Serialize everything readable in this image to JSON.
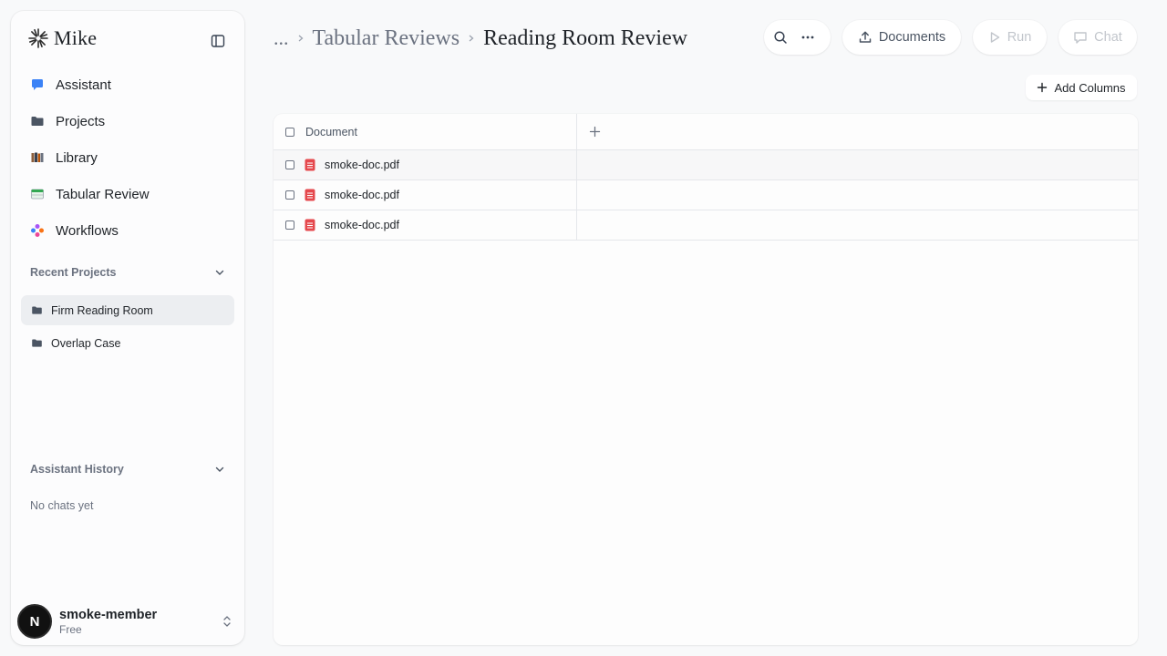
{
  "brand": {
    "name": "Mike"
  },
  "nav": [
    {
      "label": "Assistant",
      "icon": "chat-bubble-icon"
    },
    {
      "label": "Projects",
      "icon": "folder-icon"
    },
    {
      "label": "Library",
      "icon": "books-icon"
    },
    {
      "label": "Tabular Review",
      "icon": "table-icon"
    },
    {
      "label": "Workflows",
      "icon": "workflow-icon"
    }
  ],
  "recent_projects": {
    "title": "Recent Projects",
    "items": [
      {
        "label": "Firm Reading Room",
        "active": true
      },
      {
        "label": "Overlap Case",
        "active": false
      }
    ]
  },
  "assistant_history": {
    "title": "Assistant History",
    "empty_text": "No chats yet"
  },
  "account": {
    "initial": "N",
    "name": "smoke-member",
    "plan": "Free"
  },
  "breadcrumb": {
    "more": "...",
    "parent": "Tabular Reviews",
    "current": "Reading Room Review"
  },
  "toolbar": {
    "documents_label": "Documents",
    "run_label": "Run",
    "chat_label": "Chat",
    "add_columns_label": "Add Columns"
  },
  "table": {
    "header": "Document",
    "rows": [
      {
        "file": "smoke-doc.pdf"
      },
      {
        "file": "smoke-doc.pdf"
      },
      {
        "file": "smoke-doc.pdf"
      }
    ]
  },
  "colors": {
    "background": "#f8f9fa",
    "pdf_red": "#e5484d",
    "accent_blue": "#3b82f6",
    "disabled": "#c2c6cc"
  }
}
